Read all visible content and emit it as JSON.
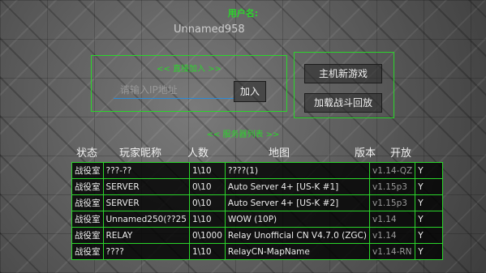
{
  "header": {
    "username_label": "用户名:",
    "username": "Unnamed958"
  },
  "join": {
    "title": "<< 直接加入 >>",
    "ip_placeholder": "请输入IP地址",
    "join_label": "加入"
  },
  "host": {
    "new_game_label": "主机新游戏",
    "replay_label": "加载战斗回放"
  },
  "server_list": {
    "title": "<< 服务器列表 >>",
    "columns": [
      "状态",
      "玩家昵称",
      "人数",
      "地图",
      "版本",
      "开放"
    ],
    "rows": [
      [
        "战役室",
        "???-??",
        "1\\10",
        "????(1)",
        "v1.14-QZ",
        "Y"
      ],
      [
        "战役室",
        "SERVER",
        "0\\10",
        "Auto Server 4+ [US-K #1]",
        "v1.15p3",
        "Y"
      ],
      [
        "战役室",
        "SERVER",
        "0\\10",
        "Auto Server 4+ [US-K #2]",
        "v1.15p3",
        "Y"
      ],
      [
        "战役室",
        "Unnamed250(??25",
        "1\\10",
        "WOW (10P)",
        "v1.14",
        "Y"
      ],
      [
        "战役室",
        "RELAY",
        "0\\1000",
        "Relay Unofficial CN V4.7.0 (ZGC)",
        "v1.14",
        "Y"
      ],
      [
        "战役室",
        "????",
        "1\\10",
        "RelayCN-MapName",
        "v1.14-RN",
        "Y"
      ]
    ]
  },
  "colors": {
    "accent": "#2bd52b",
    "input_underline": "#2a8bd8"
  }
}
